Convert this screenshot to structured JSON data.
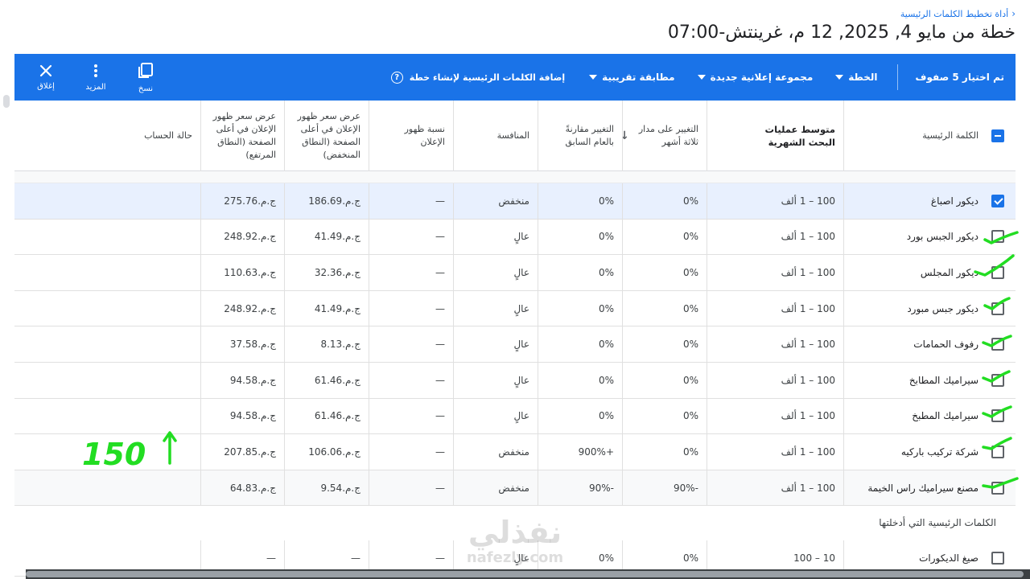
{
  "header": {
    "breadcrumb": "أداة تخطيط الكلمات الرئيسية",
    "title": "خطة من مايو 4, 2025, 12 م، غرينتش-07:00"
  },
  "toolbar": {
    "selected_text": "تم اختيار 5 صفوف",
    "plan_label": "الخطة",
    "ad_group_label": "مجموعة إعلانية جديدة",
    "match_label": "مطابقة تقريبية",
    "add_label": "إضافة الكلمات الرئيسية لإنشاء خطة",
    "copy_label": "نسخ",
    "more_label": "المزيد",
    "close_label": "إغلاق",
    "color": "#1a73e8"
  },
  "columns": {
    "keyword": "الكلمة الرئيسية",
    "avg_searches": "متوسط عمليات البحث الشهرية",
    "three_month": "التغيير على مدار ثلاثة أشهر",
    "yoy": "التغيير مقارنةً بالعام السابق",
    "competition": "المنافسة",
    "impression_share": "نسبة ظهور الإعلان",
    "bid_low": "عرض سعر ظهور الإعلان في أعلى الصفحة (النطاق المنخفض)",
    "bid_high": "عرض سعر ظهور الإعلان في أعلى الصفحة (النطاق المرتفع)",
    "account_status": "حالة الحساب"
  },
  "rows": [
    {
      "kw": "ديكور اصباغ",
      "avg": "100 – 1 ألف",
      "m3": "0%",
      "yoy": "0%",
      "comp": "منخفض",
      "share": "—",
      "low": "ج.م.186.69",
      "high": "ج.م.275.76",
      "status": ""
    },
    {
      "kw": "ديكور الجبس بورد",
      "avg": "100 – 1 ألف",
      "m3": "0%",
      "yoy": "0%",
      "comp": "عالٍ",
      "share": "—",
      "low": "ج.م.41.49",
      "high": "ج.م.248.92",
      "status": ""
    },
    {
      "kw": "ديكور المجلس",
      "avg": "100 – 1 ألف",
      "m3": "0%",
      "yoy": "0%",
      "comp": "عالٍ",
      "share": "—",
      "low": "ج.م.32.36",
      "high": "ج.م.110.63",
      "status": ""
    },
    {
      "kw": "ديكور جبس مبورد",
      "avg": "100 – 1 ألف",
      "m3": "0%",
      "yoy": "0%",
      "comp": "عالٍ",
      "share": "—",
      "low": "ج.م.41.49",
      "high": "ج.م.248.92",
      "status": ""
    },
    {
      "kw": "رفوف الحمامات",
      "avg": "100 – 1 ألف",
      "m3": "0%",
      "yoy": "0%",
      "comp": "عالٍ",
      "share": "—",
      "low": "ج.م.8.13",
      "high": "ج.م.37.58",
      "status": ""
    },
    {
      "kw": "سيراميك المطابخ",
      "avg": "100 – 1 ألف",
      "m3": "0%",
      "yoy": "0%",
      "comp": "عالٍ",
      "share": "—",
      "low": "ج.م.61.46",
      "high": "ج.م.94.58",
      "status": ""
    },
    {
      "kw": "سيراميك المطبخ",
      "avg": "100 – 1 ألف",
      "m3": "0%",
      "yoy": "0%",
      "comp": "عالٍ",
      "share": "—",
      "low": "ج.م.61.46",
      "high": "ج.م.94.58",
      "status": ""
    },
    {
      "kw": "شركة تركيب باركيه",
      "avg": "100 – 1 ألف",
      "m3": "0%",
      "yoy": "+900%",
      "comp": "منخفض",
      "share": "—",
      "low": "ج.م.106.06",
      "high": "ج.م.207.85",
      "status": ""
    },
    {
      "kw": "مصنع سيراميك راس الخيمة",
      "avg": "100 – 1 ألف",
      "m3": "-90%",
      "yoy": "-90%",
      "comp": "منخفض",
      "share": "—",
      "low": "ج.م.9.54",
      "high": "ج.م.64.83",
      "status": ""
    }
  ],
  "section": {
    "entered_label": "الكلمات الرئيسية التي أدخلتها"
  },
  "entered_rows": [
    {
      "kw": "صيغ الديكورات",
      "avg": "10 – 100",
      "m3": "0%",
      "yoy": "0%",
      "comp": "عالٍ",
      "share": "—",
      "low": "—",
      "high": "—",
      "status": ""
    }
  ],
  "annotation": {
    "note": "150",
    "color": "#22dd22"
  },
  "watermark": {
    "line1": "نفذلي",
    "line2": "nafezly.com"
  }
}
